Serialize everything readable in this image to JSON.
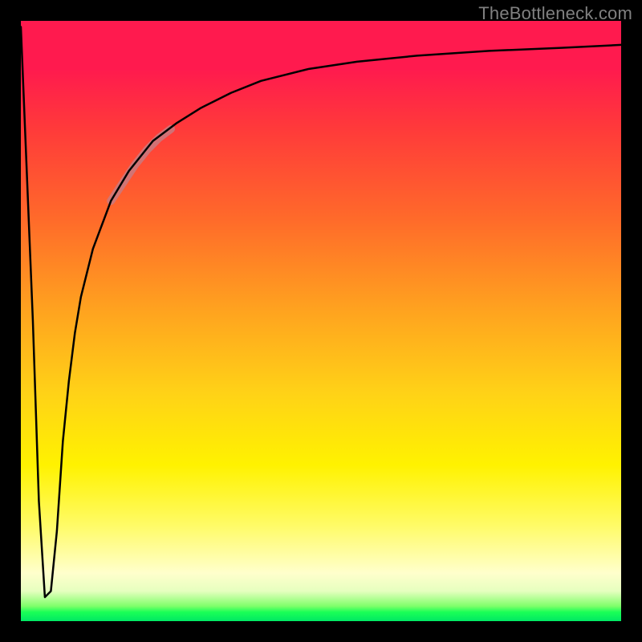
{
  "watermark": "TheBottleneck.com",
  "chart_data": {
    "type": "line",
    "title": "",
    "xlabel": "",
    "ylabel": "",
    "xlim": [
      0,
      100
    ],
    "ylim": [
      0,
      100
    ],
    "grid": false,
    "series": [
      {
        "name": "main-curve",
        "x": [
          0,
          2,
          3,
          4,
          5,
          6,
          7,
          8,
          9,
          10,
          12,
          15,
          18,
          22,
          26,
          30,
          35,
          40,
          48,
          56,
          66,
          78,
          90,
          100
        ],
        "y": [
          99,
          50,
          20,
          4,
          5,
          15,
          30,
          40,
          48,
          54,
          62,
          70,
          75,
          80,
          83,
          85.5,
          88,
          90,
          92,
          93.2,
          94.2,
          95,
          95.5,
          96
        ],
        "stroke": "#000000",
        "stroke_width": 2.5
      },
      {
        "name": "highlight-segment",
        "x": [
          15,
          17,
          19,
          21,
          23,
          25
        ],
        "y": [
          70,
          73,
          76,
          78.5,
          80.5,
          82
        ],
        "stroke": "#c97a80",
        "stroke_width": 10,
        "opacity": 0.85
      }
    ]
  }
}
